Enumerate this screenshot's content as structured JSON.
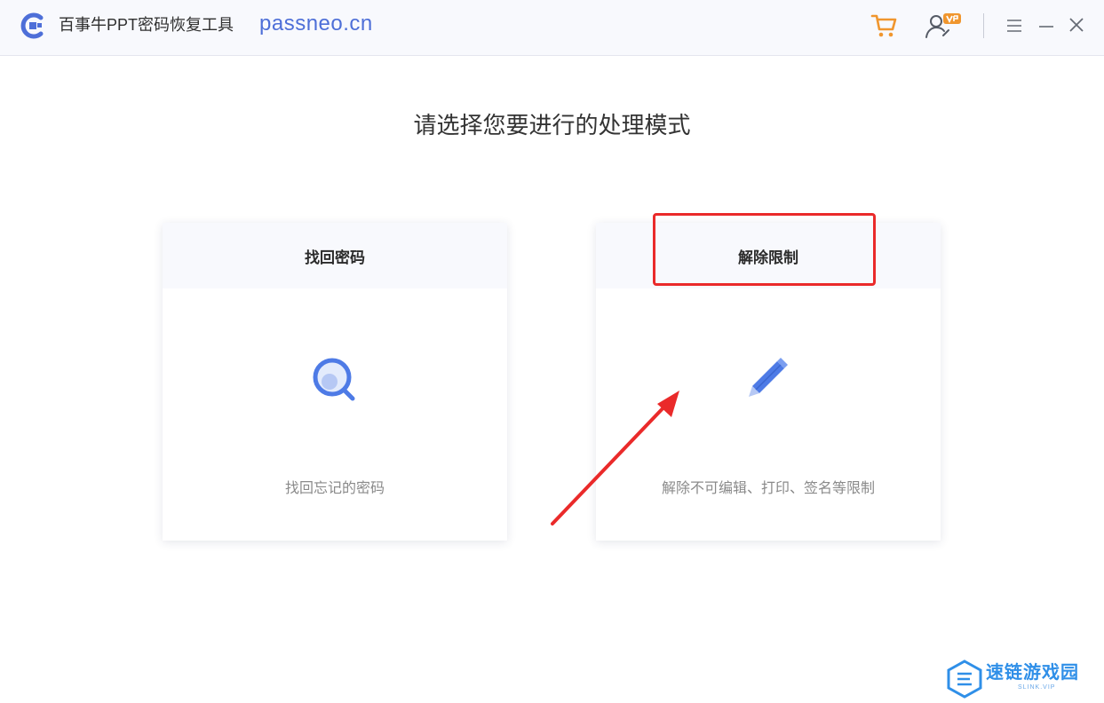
{
  "titlebar": {
    "app_name": "百事牛PPT密码恢复工具",
    "url": "passneo.cn",
    "icons": [
      "app-logo",
      "cart-icon",
      "user-vip-icon",
      "menu-icon",
      "minimize-icon",
      "close-icon"
    ]
  },
  "main": {
    "heading": "请选择您要进行的处理模式",
    "cards": [
      {
        "title": "找回密码",
        "description": "找回忘记的密码",
        "icon": "search-icon"
      },
      {
        "title": "解除限制",
        "description": "解除不可编辑、打印、签名等限制",
        "icon": "pencil-icon"
      }
    ]
  },
  "annotation": {
    "highlight_color": "#ea2a2a"
  },
  "watermark": {
    "text": "速链游戏园",
    "sub": "SLINK.VIP"
  },
  "colors": {
    "accent": "#4e6fd8",
    "cart": "#f0962e",
    "badge": "#f0962e",
    "titlebar_bg": "#f8f9fd"
  }
}
